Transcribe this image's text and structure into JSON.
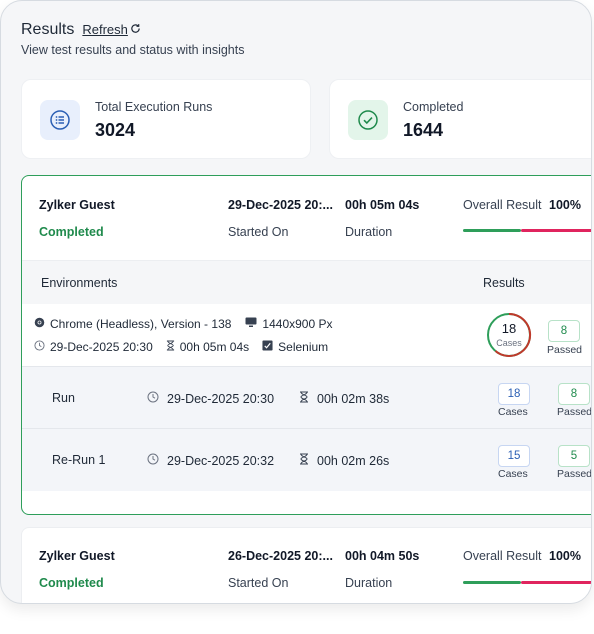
{
  "header": {
    "title": "Results",
    "refresh_label": "Refresh",
    "subtitle": "View test results and status with insights"
  },
  "stats": [
    {
      "label": "Total Execution Runs",
      "value": "3024",
      "icon": "list-icon"
    },
    {
      "label": "Completed",
      "value": "1644",
      "icon": "check-circle-icon"
    }
  ],
  "runs": [
    {
      "user": "Zylker Guest",
      "status": "Completed",
      "started_on": "29-Dec-2025 20:...",
      "started_label": "Started On",
      "duration": "00h 05m 04s",
      "duration_label": "Duration",
      "overall_label": "Overall Result",
      "overall_value": "100%",
      "environments_header": "Environments",
      "results_header": "Results",
      "environment": {
        "browser": "Chrome (Headless), Version - 138",
        "resolution": "1440x900 Px",
        "date": "29-Dec-2025 20:30",
        "duration": "00h 05m 04s",
        "framework": "Selenium",
        "cases_count": "18",
        "cases_label": "Cases",
        "passed_count": "8",
        "passed_label": "Passed"
      },
      "sub_runs": [
        {
          "name": "Run",
          "date": "29-Dec-2025 20:30",
          "duration": "00h 02m 38s",
          "cases": "18",
          "cases_label": "Cases",
          "passed": "8",
          "passed_label": "Passed"
        },
        {
          "name": "Re-Run 1",
          "date": "29-Dec-2025 20:32",
          "duration": "00h 02m 26s",
          "cases": "15",
          "cases_label": "Cases",
          "passed": "5",
          "passed_label": "Passed"
        }
      ]
    },
    {
      "user": "Zylker Guest",
      "status": "Completed",
      "started_on": "26-Dec-2025 20:...",
      "started_label": "Started On",
      "duration": "00h 04m 50s",
      "duration_label": "Duration",
      "overall_label": "Overall Result",
      "overall_value": "100%"
    }
  ],
  "colors": {
    "pass": "#2e9e5a",
    "fail": "#e0245e",
    "accent_blue": "#2b5fb4"
  },
  "progress": {
    "run1_pass_fraction": 0.46,
    "run2_pass_fraction": 0.46
  }
}
